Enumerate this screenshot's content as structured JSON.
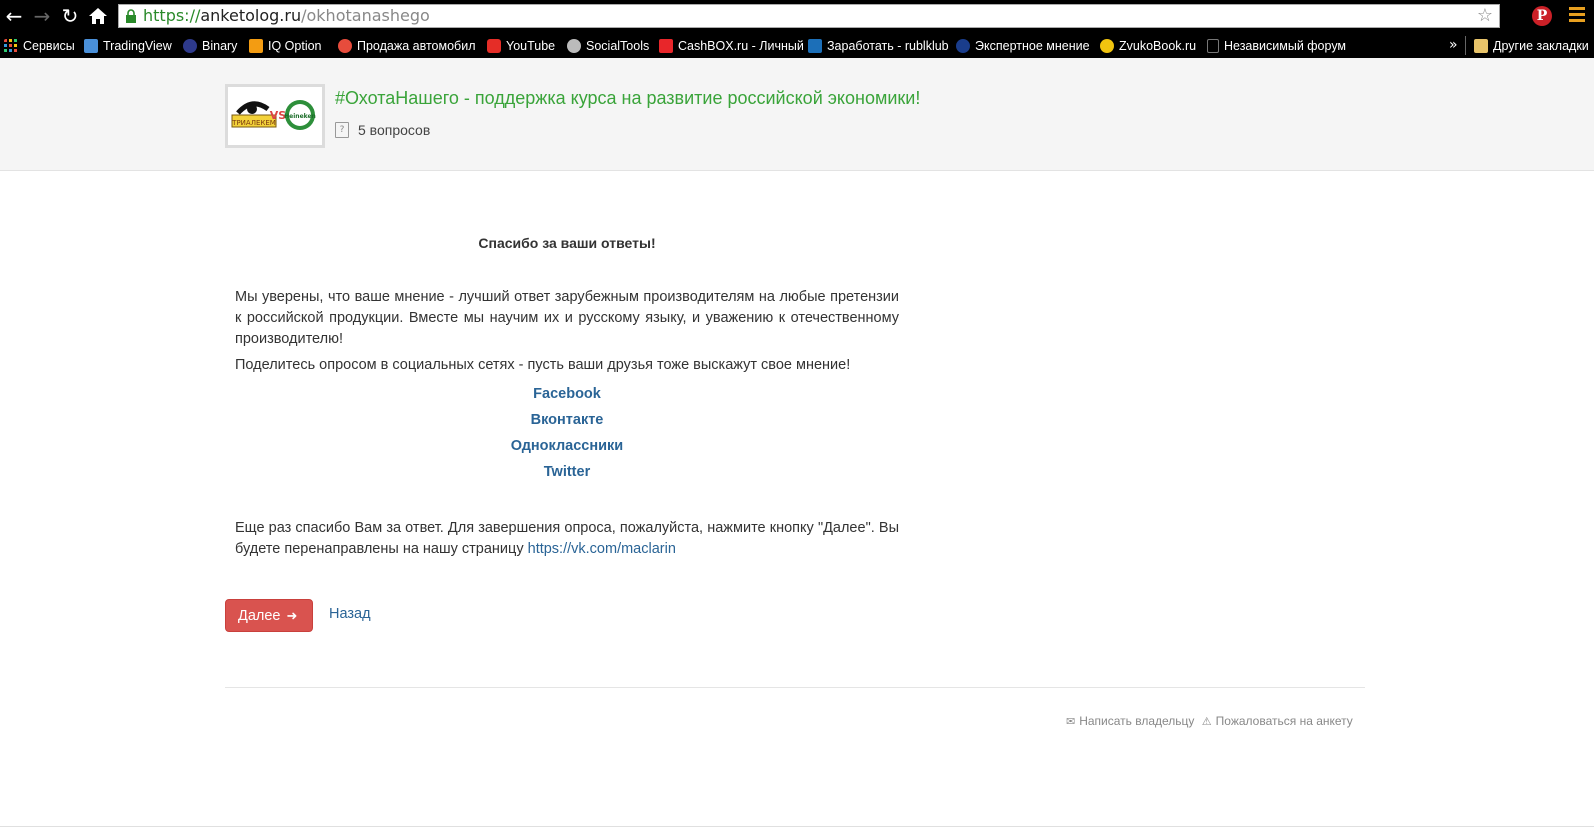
{
  "browser": {
    "url_scheme": "https://",
    "url_host": "anketolog.ru",
    "url_path": "/okhotanashego",
    "bookmarks": [
      {
        "label": "Сервисы",
        "color": "#e84c3d"
      },
      {
        "label": "TradingView",
        "color": "#4a90d9"
      },
      {
        "label": "Binary",
        "color": "#2e3a8c"
      },
      {
        "label": "IQ Option",
        "color": "#f39c12"
      },
      {
        "label": "Продажа автомобил",
        "color": "#e74c3c"
      },
      {
        "label": "YouTube",
        "color": "#e52d27"
      },
      {
        "label": "SocialTools",
        "color": "#bbbbbb"
      },
      {
        "label": "CashBOX.ru - Личный",
        "color": "#e8262a"
      },
      {
        "label": "Заработать - rublklub",
        "color": "#1c6fb8"
      },
      {
        "label": "Экспертное мнение",
        "color": "#1a3d8c"
      },
      {
        "label": "ZvukoBook.ru",
        "color": "#f1c40f"
      },
      {
        "label": "Независимый форум",
        "color": "#777777"
      }
    ],
    "overflow_label": "»",
    "other_bookmarks": "Другие закладки"
  },
  "header": {
    "logo_text_left": "ТРИАЛЕКЕМ",
    "logo_text_right": "Heineken",
    "logo_vs": "VS",
    "title": "#ОхотаНашего - поддержка курса на развитие российской экономики!",
    "question_count": "5 вопросов"
  },
  "content": {
    "thanks_title": "Спасибо за ваши ответы!",
    "para1": "Мы уверены, что ваше мнение - лучший ответ зарубежным производителям на любые претензии к российской продукции. Вместе мы научим их и русскому языку, и уважению к отечественному производителю!",
    "para2": "Поделитесь опросом в социальных сетях - пусть ваши друзья тоже выскажут свое мнение!",
    "share": [
      "Facebook",
      "Вконтакте",
      "Одноклассники",
      "Twitter"
    ],
    "final_text": "Еще раз спасибо Вам за ответ. Для завершения опроса, пожалуйста, нажмите кнопку \"Далее\". Вы будете перенаправлены на нашу страницу ",
    "final_link": "https://vk.com/maclarin"
  },
  "actions": {
    "next_label": "Далее",
    "back_label": "Назад"
  },
  "footer": {
    "write_owner": "Написать владельцу",
    "report": "Пожаловаться на анкету"
  }
}
